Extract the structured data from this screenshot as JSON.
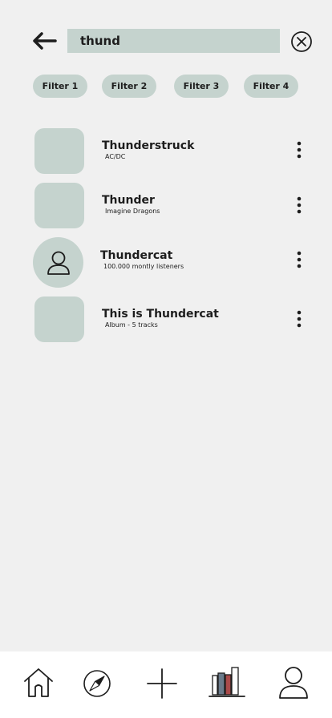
{
  "search": {
    "query": "thund"
  },
  "filters": [
    "Filter 1",
    "Filter 2",
    "Filter 3",
    "Filter 4"
  ],
  "results": [
    {
      "title": "Thunderstruck",
      "subtitle": "AC/DC",
      "type": "track"
    },
    {
      "title": "Thunder",
      "subtitle": "Imagine Dragons",
      "type": "track"
    },
    {
      "title": "Thundercat",
      "subtitle": "100.000 montly listeners",
      "type": "artist"
    },
    {
      "title": "This is Thundercat",
      "subtitle": "Album - 5 tracks",
      "type": "album"
    }
  ],
  "nav": {
    "items": [
      "home-icon",
      "compass-icon",
      "plus-icon",
      "library-icon",
      "profile-icon"
    ]
  },
  "colors": {
    "accent": "#c5d3ce",
    "background": "#f0f0f0",
    "nav_background": "#ffffff",
    "text": "#1d1d1d"
  }
}
